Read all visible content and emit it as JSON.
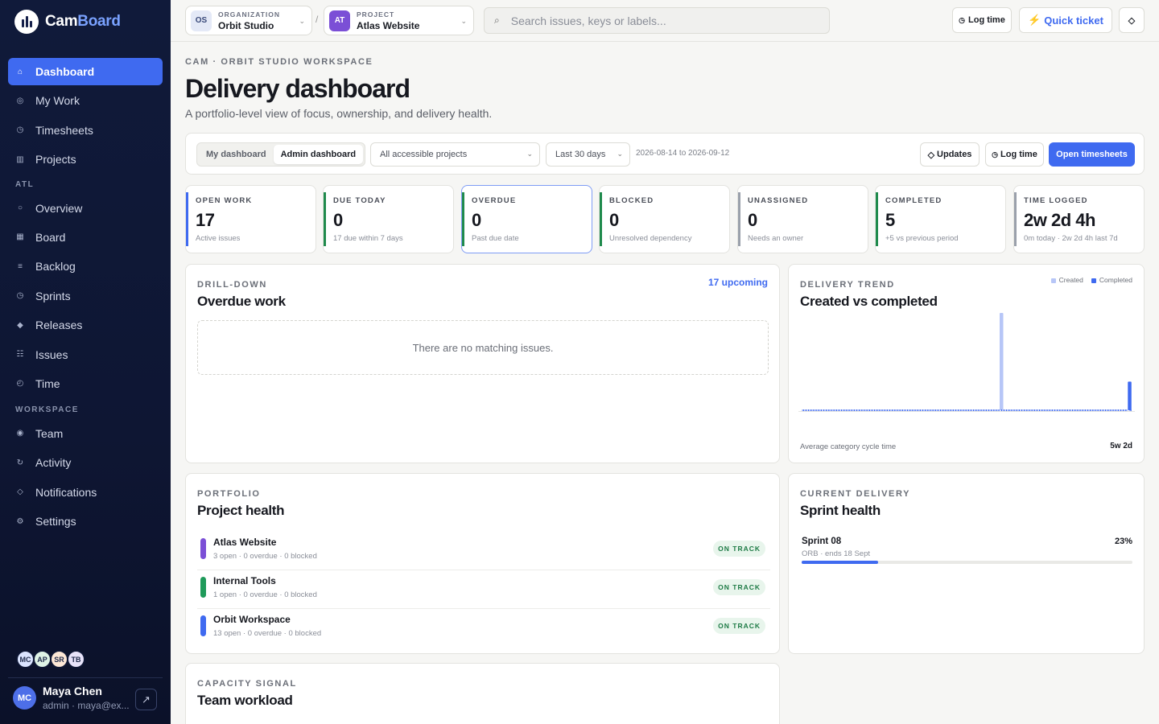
{
  "app": {
    "logo_a": "Cam",
    "logo_b": "Board"
  },
  "sidebar": {
    "items": [
      {
        "label": "Dashboard",
        "icon": "home-icon",
        "glyph": "⌂",
        "active": true
      },
      {
        "label": "My Work",
        "icon": "target-icon",
        "glyph": "◎"
      },
      {
        "label": "Timesheets",
        "icon": "clock-icon",
        "glyph": "◷"
      },
      {
        "label": "Projects",
        "icon": "folder-icon",
        "glyph": "▥"
      }
    ],
    "group_atl": "ATL",
    "atl_items": [
      {
        "label": "Overview",
        "icon": "circle-icon",
        "glyph": "○"
      },
      {
        "label": "Board",
        "icon": "board-icon",
        "glyph": "▦"
      },
      {
        "label": "Backlog",
        "icon": "list-icon",
        "glyph": "≡"
      },
      {
        "label": "Sprints",
        "icon": "sprint-icon",
        "glyph": "◷"
      },
      {
        "label": "Releases",
        "icon": "diamond-icon",
        "glyph": "◆"
      },
      {
        "label": "Issues",
        "icon": "issues-icon",
        "glyph": "☷"
      },
      {
        "label": "Time",
        "icon": "time-icon",
        "glyph": "◴"
      }
    ],
    "group_workspace": "WORKSPACE",
    "workspace_items": [
      {
        "label": "Team",
        "icon": "team-icon",
        "glyph": "◉"
      },
      {
        "label": "Activity",
        "icon": "activity-icon",
        "glyph": "↻"
      },
      {
        "label": "Notifications",
        "icon": "bell-icon",
        "glyph": "◇"
      },
      {
        "label": "Settings",
        "icon": "gear-icon",
        "glyph": "⚙"
      }
    ],
    "avatars": [
      {
        "initials": "MC",
        "color": "#dbe4ff"
      },
      {
        "initials": "AP",
        "color": "#dff3e6"
      },
      {
        "initials": "SR",
        "color": "#fde7d6"
      },
      {
        "initials": "TB",
        "color": "#e8e3fa"
      }
    ],
    "user": {
      "initials": "MC",
      "name": "Maya Chen",
      "sub": "admin · maya@ex..."
    }
  },
  "topbar": {
    "org": {
      "badge": "OS",
      "label": "ORGANIZATION",
      "value": "Orbit Studio"
    },
    "separator": "/",
    "project": {
      "badge": "AT",
      "label": "PROJECT",
      "value": "Atlas Website"
    },
    "search_placeholder": "Search issues, keys or labels...",
    "log_time": "Log time",
    "quick_ticket": "Quick ticket",
    "theme_icon": "◇"
  },
  "header": {
    "eyebrow": "CAM · ORBIT STUDIO WORKSPACE",
    "title": "Delivery dashboard",
    "subtitle": "A portfolio-level view of focus, ownership, and delivery health."
  },
  "filters": {
    "tabs": [
      "My dashboard",
      "Admin dashboard"
    ],
    "active_tab": 1,
    "scope": "All accessible projects",
    "period": "Last 30 days",
    "date_range": "2026-08-14 to 2026-09-12",
    "updates": "Updates",
    "log_time": "Log time",
    "open_timesheets": "Open timesheets"
  },
  "kpis": [
    {
      "label": "OPEN WORK",
      "value": "17",
      "sub": "Active issues",
      "color": "#3f6af0"
    },
    {
      "label": "DUE TODAY",
      "value": "0",
      "sub": "17 due within 7 days",
      "color": "#1f8a4c"
    },
    {
      "label": "OVERDUE",
      "value": "0",
      "sub": "Past due date",
      "color": "#1f8a4c",
      "selected": true
    },
    {
      "label": "BLOCKED",
      "value": "0",
      "sub": "Unresolved dependency",
      "color": "#1f8a4c"
    },
    {
      "label": "UNASSIGNED",
      "value": "0",
      "sub": "Needs an owner",
      "color": "#9aa0ab"
    },
    {
      "label": "COMPLETED",
      "value": "5",
      "sub": "+5 vs previous period",
      "color": "#1f8a4c"
    },
    {
      "label": "TIME LOGGED",
      "value": "2w 2d 4h",
      "sub": "0m today · 2w 2d 4h last 7d",
      "color": "#9aa0ab"
    }
  ],
  "overdue": {
    "eyebrow": "DRILL-DOWN",
    "title": "Overdue work",
    "link": "17 upcoming",
    "empty": "There are no matching issues."
  },
  "trend": {
    "eyebrow": "DELIVERY TREND",
    "title": "Created vs completed",
    "foot_label": "Average category cycle time",
    "foot_value": "5w 2d"
  },
  "chart_data": {
    "type": "bar",
    "title": "Created vs completed",
    "series": [
      {
        "name": "Created",
        "color": "#b7c6f7",
        "values": [
          0,
          0,
          0,
          0,
          0,
          0,
          0,
          0,
          0,
          0,
          0,
          0,
          0,
          0,
          0,
          0,
          0,
          0,
          0,
          0,
          0,
          0,
          0,
          0,
          0,
          0,
          0,
          0,
          0,
          0,
          0,
          0,
          0,
          0,
          0,
          0,
          0,
          0,
          0,
          0,
          0,
          0,
          0,
          0,
          0,
          0,
          0,
          0,
          0,
          0,
          0,
          0,
          0,
          0,
          0,
          0,
          0,
          0,
          0,
          0,
          0,
          0,
          0,
          0,
          0,
          0,
          0,
          0,
          0,
          0,
          0,
          0,
          0,
          0,
          0,
          0,
          0,
          0,
          17,
          0,
          0,
          0,
          0,
          0,
          0,
          0,
          0,
          0,
          0,
          0,
          0,
          0,
          0,
          0,
          0,
          0,
          0,
          0,
          0,
          0,
          0,
          0,
          0,
          0,
          0,
          0,
          0,
          0,
          0,
          0,
          0,
          0,
          0,
          0,
          0,
          0,
          0,
          0,
          0,
          0,
          0,
          0,
          0,
          0,
          0,
          0,
          0,
          0,
          0,
          0
        ]
      },
      {
        "name": "Completed",
        "color": "#3f6af0",
        "values": [
          0,
          0,
          0,
          0,
          0,
          0,
          0,
          0,
          0,
          0,
          0,
          0,
          0,
          0,
          0,
          0,
          0,
          0,
          0,
          0,
          0,
          0,
          0,
          0,
          0,
          0,
          0,
          0,
          0,
          0,
          0,
          0,
          0,
          0,
          0,
          0,
          0,
          0,
          0,
          0,
          0,
          0,
          0,
          0,
          0,
          0,
          0,
          0,
          0,
          0,
          0,
          0,
          0,
          0,
          0,
          0,
          0,
          0,
          0,
          0,
          0,
          0,
          0,
          0,
          0,
          0,
          0,
          0,
          0,
          0,
          0,
          0,
          0,
          0,
          0,
          0,
          0,
          0,
          0,
          0,
          0,
          0,
          0,
          0,
          0,
          0,
          0,
          0,
          0,
          0,
          0,
          0,
          0,
          0,
          0,
          0,
          0,
          0,
          0,
          0,
          0,
          0,
          0,
          0,
          0,
          0,
          0,
          0,
          0,
          0,
          0,
          0,
          0,
          0,
          0,
          0,
          0,
          0,
          0,
          0,
          0,
          0,
          0,
          0,
          0,
          0,
          0,
          0,
          5,
          0
        ]
      }
    ],
    "ylim": [
      0,
      17
    ],
    "legend": "top-right",
    "grid": false
  },
  "portfolio": {
    "eyebrow": "PORTFOLIO",
    "title": "Project health",
    "projects": [
      {
        "name": "Atlas Website",
        "meta": "3 open · 0 overdue · 0 blocked",
        "status": "ON TRACK",
        "color": "#7b4fd6"
      },
      {
        "name": "Internal Tools",
        "meta": "1 open · 0 overdue · 0 blocked",
        "status": "ON TRACK",
        "color": "#1f9a5a"
      },
      {
        "name": "Orbit Workspace",
        "meta": "13 open · 0 overdue · 0 blocked",
        "status": "ON TRACK",
        "color": "#3f6af0"
      }
    ]
  },
  "sprint": {
    "eyebrow": "CURRENT DELIVERY",
    "title": "Sprint health",
    "name": "Sprint 08",
    "meta": "ORB · ends 18 Sept",
    "pct_label": "23%",
    "progress": 0.23
  },
  "workload": {
    "eyebrow": "CAPACITY SIGNAL",
    "title": "Team workload"
  }
}
